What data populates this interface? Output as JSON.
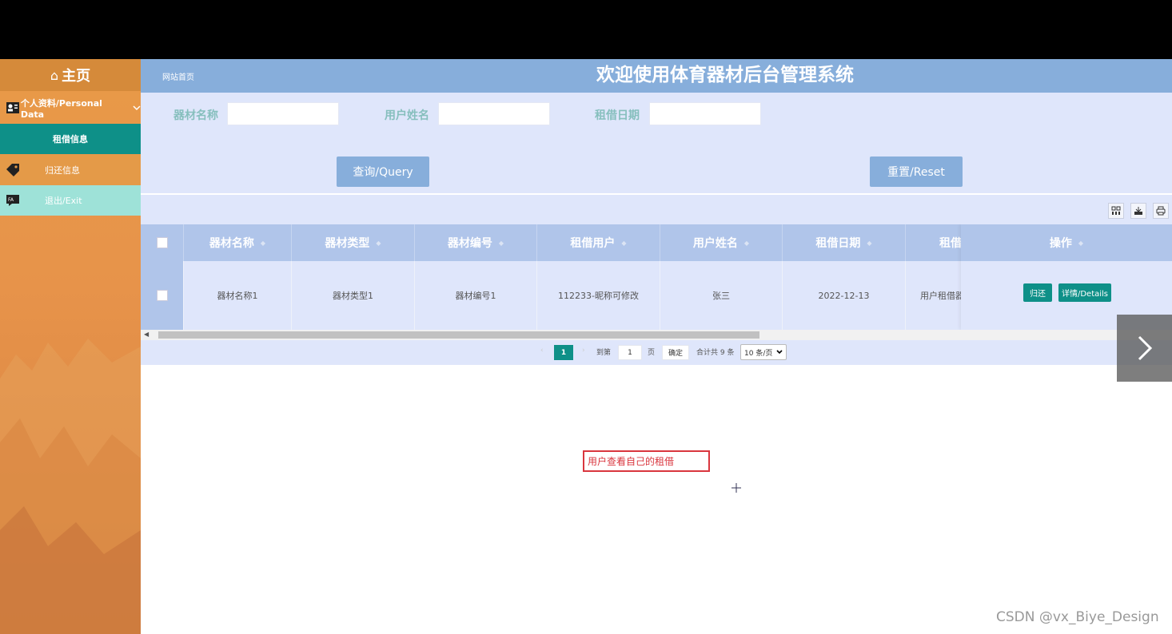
{
  "sidebar": {
    "home_label": "主页",
    "items": [
      {
        "label": "个人资料/Personal Data",
        "icon": "id-card-icon"
      },
      {
        "label": "租借信息"
      },
      {
        "label": "归还信息",
        "icon": "tag-icon"
      },
      {
        "label": "退出/Exit",
        "icon": "exit-icon"
      }
    ]
  },
  "header": {
    "breadcrumb": "网站首页",
    "title": "欢迎使用体育器材后台管理系统"
  },
  "search": {
    "fields": [
      {
        "label": "器材名称",
        "value": ""
      },
      {
        "label": "用户姓名",
        "value": ""
      },
      {
        "label": "租借日期",
        "value": ""
      }
    ],
    "query_label": "查询/Query",
    "reset_label": "重置/Reset"
  },
  "table": {
    "columns": [
      "器材名称",
      "器材类型",
      "器材编号",
      "租借用户",
      "用户姓名",
      "租借日期",
      "租借",
      "操作"
    ],
    "rows": [
      {
        "cells": [
          "器材名称1",
          "器材类型1",
          "器材编号1",
          "112233-昵称可修改",
          "张三",
          "2022-12-13",
          "用户租借器"
        ]
      }
    ],
    "actions": {
      "return_label": "归还",
      "details_label": "详情/Details"
    }
  },
  "pagination": {
    "current_page": "1",
    "goto_label": "到第",
    "goto_value": "1",
    "page_unit": "页",
    "confirm_label": "确定",
    "total_label": "合计共 9 条",
    "page_size": "10 条/页"
  },
  "annotation": "用户查看自己的租借",
  "watermark": "CSDN @vx_Biye_Design",
  "colors": {
    "accent": "#0e9088",
    "header": "#87aedb",
    "sidebar": "#e89a48",
    "panel": "#dfe6fb"
  }
}
